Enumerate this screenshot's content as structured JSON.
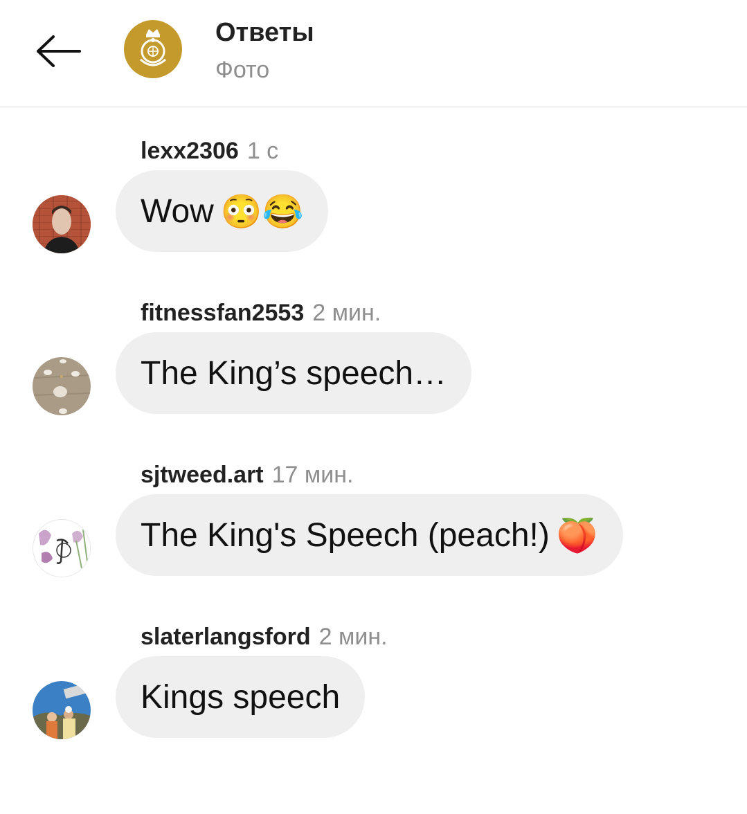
{
  "header": {
    "title": "Ответы",
    "subtitle": "Фото",
    "back_icon": "arrow-left-icon",
    "avatar_icon": "crown-emblem-icon",
    "avatar_color": "#c49a2c"
  },
  "comments": [
    {
      "username": "lexx2306",
      "time": "1 с",
      "text": "Wow",
      "emoji": "😳😂",
      "avatar": "user-photo-avatar"
    },
    {
      "username": "fitnessfan2553",
      "time": "2 мин.",
      "text": "The King’s speech…",
      "emoji": "",
      "avatar": "stones-photo-avatar"
    },
    {
      "username": "sjtweed.art",
      "time": "17 мин.",
      "text": "The King's Speech (peach!)",
      "emoji": "🍑",
      "avatar": "flower-art-avatar"
    },
    {
      "username": "slaterlangsford",
      "time": "2 мин.",
      "text": "Kings speech",
      "emoji": "",
      "avatar": "outdoor-photo-avatar"
    }
  ],
  "colors": {
    "bubble": "#efefef",
    "muted_text": "#8e8e8e",
    "divider": "#dcdcdc"
  }
}
